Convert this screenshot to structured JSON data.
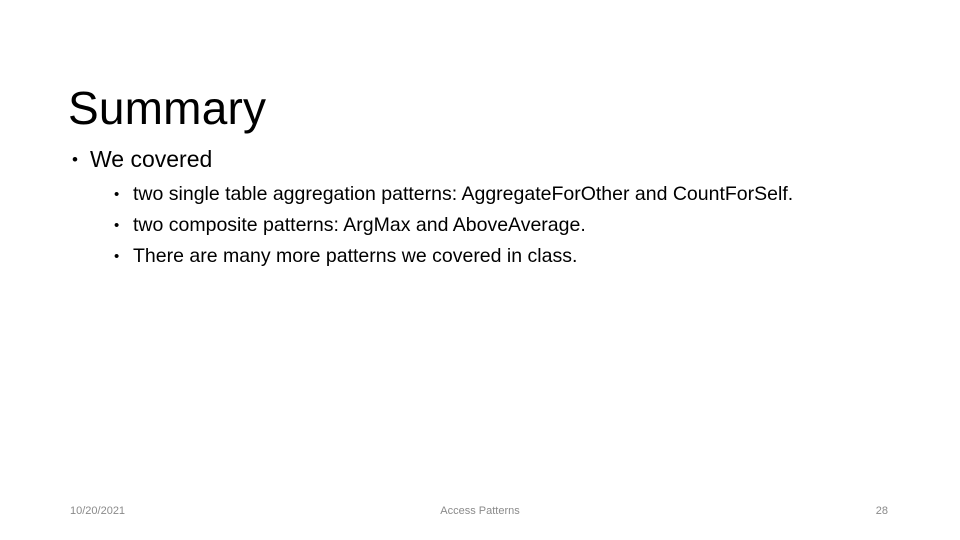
{
  "slide": {
    "title": "Summary",
    "bullets": [
      {
        "text": "We covered",
        "children": [
          "two single table aggregation patterns: AggregateForOther and CountForSelf.",
          "two composite patterns: ArgMax and AboveAverage.",
          "There are many more patterns we covered in class."
        ]
      }
    ],
    "footer": {
      "date": "10/20/2021",
      "center": "Access Patterns",
      "page_number": "28"
    },
    "colors": {
      "background": "#ffffff",
      "text": "#000000",
      "footer_text": "#8a8a8a"
    }
  }
}
